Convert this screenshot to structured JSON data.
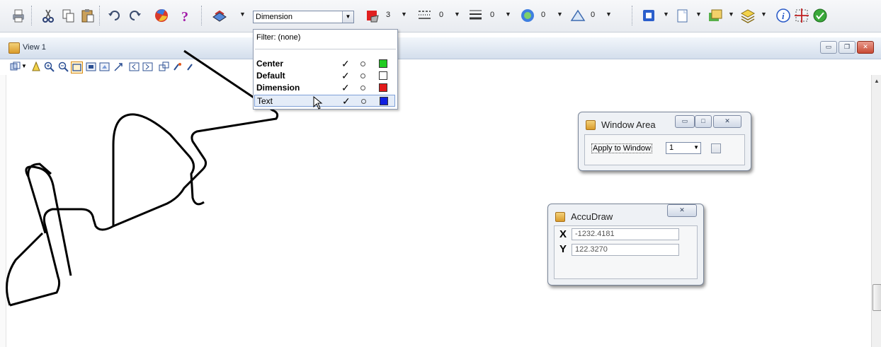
{
  "toolbar": {
    "active_symbology": "Dimension",
    "counts": {
      "c1": "3",
      "c2": "0",
      "c3": "0",
      "c4": "0",
      "c5": "0"
    }
  },
  "symbology_dropdown": {
    "filter_label": "Filter: (none)",
    "items": [
      {
        "name": "Center",
        "color": "#22cc22",
        "checked": true
      },
      {
        "name": "Default",
        "color": "#ffffff",
        "checked": true
      },
      {
        "name": "Dimension",
        "color": "#e21a1a",
        "checked": true
      },
      {
        "name": "Text",
        "color": "#1020e0",
        "checked": true
      }
    ]
  },
  "view": {
    "title": "View 1"
  },
  "window_area": {
    "title": "Window Area",
    "apply_label": "Apply to Window",
    "window_value": "1"
  },
  "accudraw": {
    "title": "AccuDraw",
    "x_label": "X",
    "x_value": "-1232.4181",
    "y_label": "Y",
    "y_value": "122.3270"
  },
  "window_buttons": {
    "minimize": "▭",
    "restore": "❐",
    "maximize": "□",
    "close": "✕"
  }
}
